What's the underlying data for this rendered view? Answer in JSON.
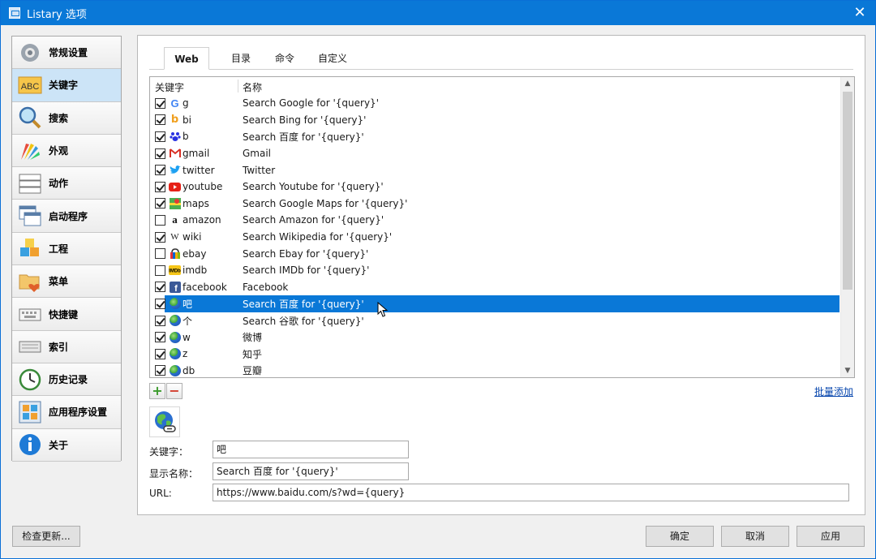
{
  "window": {
    "title": "Listary 选项"
  },
  "sidebar": {
    "items": [
      {
        "label": "常规设置",
        "icon": "gear-icon"
      },
      {
        "label": "关键字",
        "icon": "abc-icon"
      },
      {
        "label": "搜索",
        "icon": "magnifier-icon"
      },
      {
        "label": "外观",
        "icon": "palette-icon"
      },
      {
        "label": "动作",
        "icon": "action-icon"
      },
      {
        "label": "启动程序",
        "icon": "windows-icon"
      },
      {
        "label": "工程",
        "icon": "cubes-icon"
      },
      {
        "label": "菜单",
        "icon": "folder-heart-icon"
      },
      {
        "label": "快捷键",
        "icon": "keyboard-icon"
      },
      {
        "label": "索引",
        "icon": "index-keyboard-icon"
      },
      {
        "label": "历史记录",
        "icon": "clock-icon"
      },
      {
        "label": "应用程序设置",
        "icon": "app-grid-icon"
      },
      {
        "label": "关于",
        "icon": "info-icon"
      }
    ],
    "active_index": 1
  },
  "tabs": [
    "Web",
    "目录",
    "命令",
    "自定义"
  ],
  "list": {
    "header_keyword": "关键字",
    "header_name": "名称",
    "rows": [
      {
        "checked": true,
        "keyword": "g",
        "name": "Search Google for '{query}'",
        "icon": "google-icon"
      },
      {
        "checked": true,
        "keyword": "bi",
        "name": "Search Bing for '{query}'",
        "icon": "bing-icon"
      },
      {
        "checked": true,
        "keyword": "b",
        "name": "Search 百度 for '{query}'",
        "icon": "baidu-paw-icon"
      },
      {
        "checked": true,
        "keyword": "gmail",
        "name": "Gmail",
        "icon": "gmail-icon"
      },
      {
        "checked": true,
        "keyword": "twitter",
        "name": "Twitter",
        "icon": "twitter-icon"
      },
      {
        "checked": true,
        "keyword": "youtube",
        "name": "Search Youtube for '{query}'",
        "icon": "youtube-icon"
      },
      {
        "checked": true,
        "keyword": "maps",
        "name": "Search Google Maps for '{query}'",
        "icon": "maps-icon"
      },
      {
        "checked": false,
        "keyword": "amazon",
        "name": "Search Amazon for '{query}'",
        "icon": "amazon-icon"
      },
      {
        "checked": true,
        "keyword": "wiki",
        "name": "Search Wikipedia for '{query}'",
        "icon": "wikipedia-icon"
      },
      {
        "checked": false,
        "keyword": "ebay",
        "name": "Search Ebay for '{query}'",
        "icon": "ebay-icon"
      },
      {
        "checked": false,
        "keyword": "imdb",
        "name": "Search IMDb for '{query}'",
        "icon": "imdb-icon"
      },
      {
        "checked": true,
        "keyword": "facebook",
        "name": "Facebook",
        "icon": "facebook-icon"
      },
      {
        "checked": true,
        "keyword": "吧",
        "name": "Search 百度 for '{query}'",
        "icon": "globe-icon",
        "selected": true
      },
      {
        "checked": true,
        "keyword": "个",
        "name": "Search 谷歌 for '{query}'",
        "icon": "globe-icon"
      },
      {
        "checked": true,
        "keyword": "w",
        "name": "微博",
        "icon": "globe-icon"
      },
      {
        "checked": true,
        "keyword": "z",
        "name": "知乎",
        "icon": "globe-icon"
      },
      {
        "checked": true,
        "keyword": "db",
        "name": "豆瓣",
        "icon": "globe-icon"
      }
    ]
  },
  "batch_add_label": "批量添加",
  "form": {
    "keyword_label": "关键字：",
    "keyword_value": "吧",
    "display_name_label": "显示名称：",
    "display_name_value": "Search 百度 for '{query}'",
    "url_label": "URL:",
    "url_value": "https://www.baidu.com/s?wd={query}"
  },
  "buttons": {
    "check_update": "检查更新...",
    "ok": "确定",
    "cancel": "取消",
    "apply": "应用"
  },
  "colors": {
    "titlebar": "#0a78d7",
    "selection": "#0a78d7",
    "sidebar_active": "#cce4f7",
    "link": "#0645ad"
  }
}
